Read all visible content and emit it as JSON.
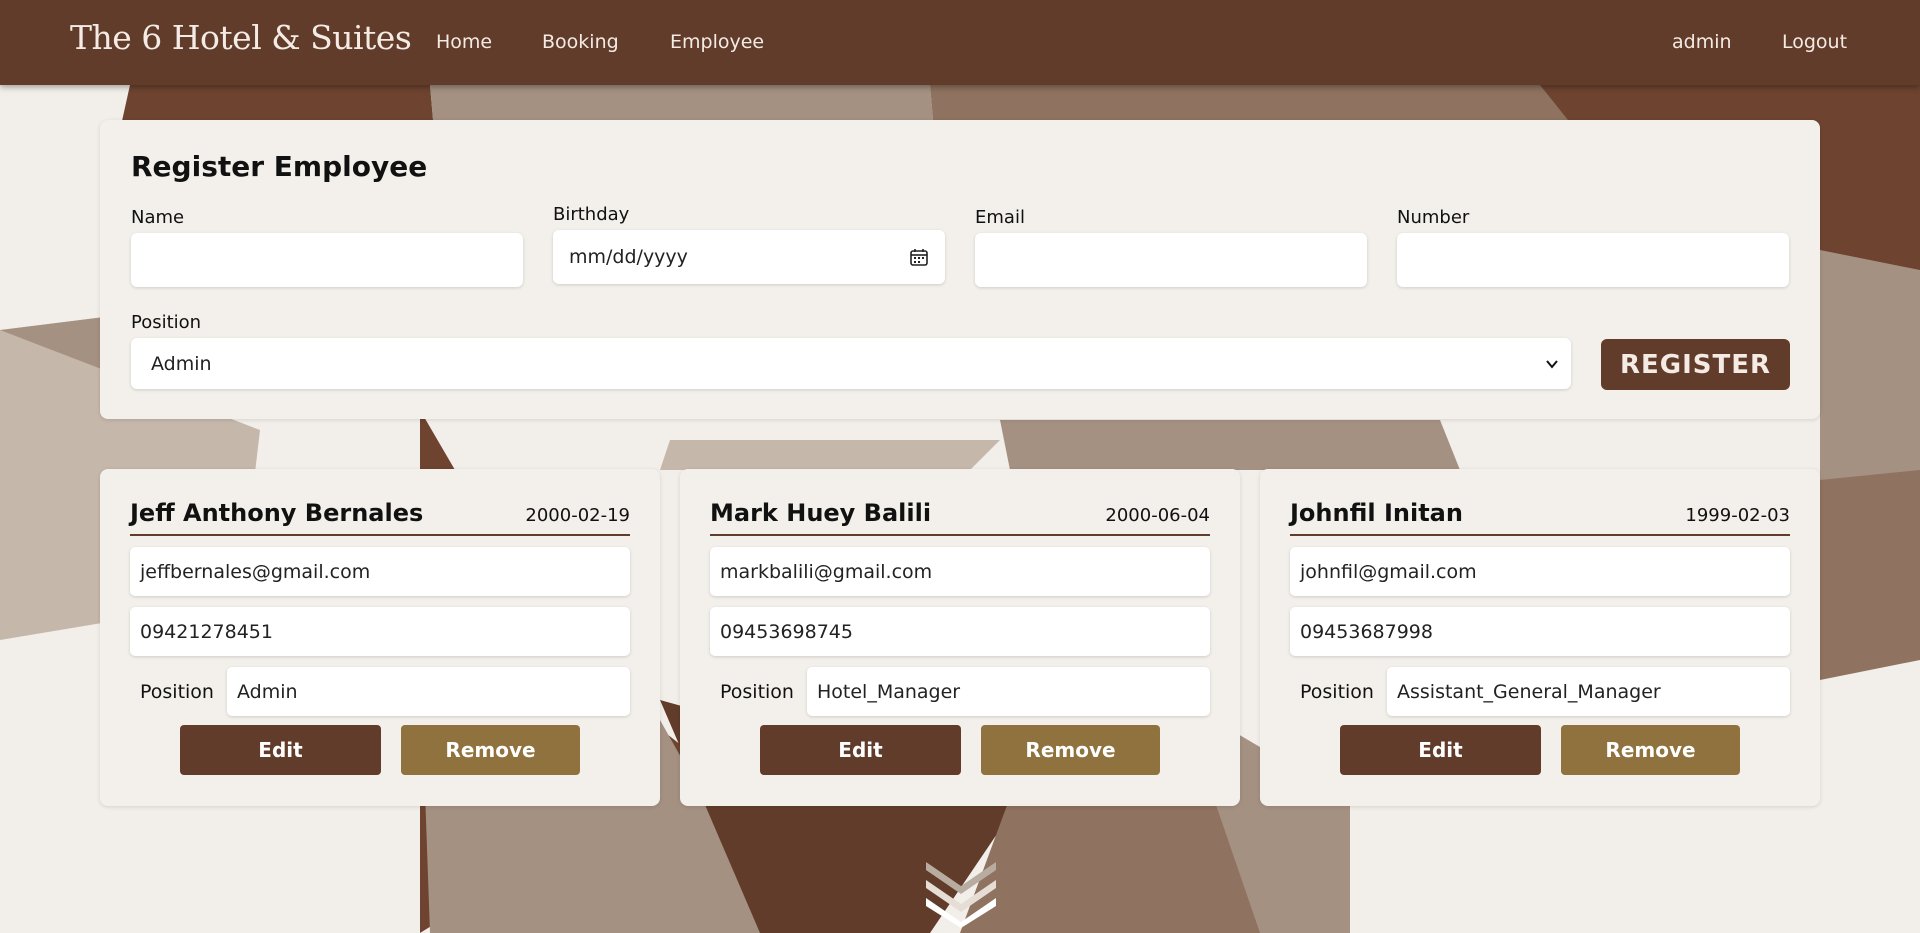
{
  "nav": {
    "brand": "The 6 Hotel & Suites",
    "links": [
      "Home",
      "Booking",
      "Employee"
    ],
    "user": "admin",
    "logout": "Logout"
  },
  "form": {
    "title": "Register Employee",
    "name_label": "Name",
    "name_value": "",
    "birthday_label": "Birthday",
    "birthday_placeholder": "mm/dd/yyyy",
    "email_label": "Email",
    "email_value": "",
    "number_label": "Number",
    "number_value": "",
    "position_label": "Position",
    "position_selected": "Admin",
    "register_label": "REGISTER"
  },
  "employees": [
    {
      "name": "Jeff Anthony Bernales",
      "birthday": "2000-02-19",
      "email": "jeffbernales@gmail.com",
      "number": "09421278451",
      "position_label": "Position",
      "position": "Admin",
      "edit_label": "Edit",
      "remove_label": "Remove"
    },
    {
      "name": "Mark Huey Balili",
      "birthday": "2000-06-04",
      "email": "markbalili@gmail.com",
      "number": "09453698745",
      "position_label": "Position",
      "position": "Hotel_Manager",
      "edit_label": "Edit",
      "remove_label": "Remove"
    },
    {
      "name": "Johnfil Initan",
      "birthday": "1999-02-03",
      "email": "johnfil@gmail.com",
      "number": "09453687998",
      "position_label": "Position",
      "position": "Assistant_General_Manager",
      "edit_label": "Edit",
      "remove_label": "Remove"
    }
  ],
  "colors": {
    "primary": "#623c2a",
    "accent": "#8f723d",
    "panel": "#f3f0eb"
  },
  "icons": {
    "birthday": "calendar-icon",
    "position": "chevron-down-icon",
    "scroll": "double-chevron-down-icon"
  }
}
